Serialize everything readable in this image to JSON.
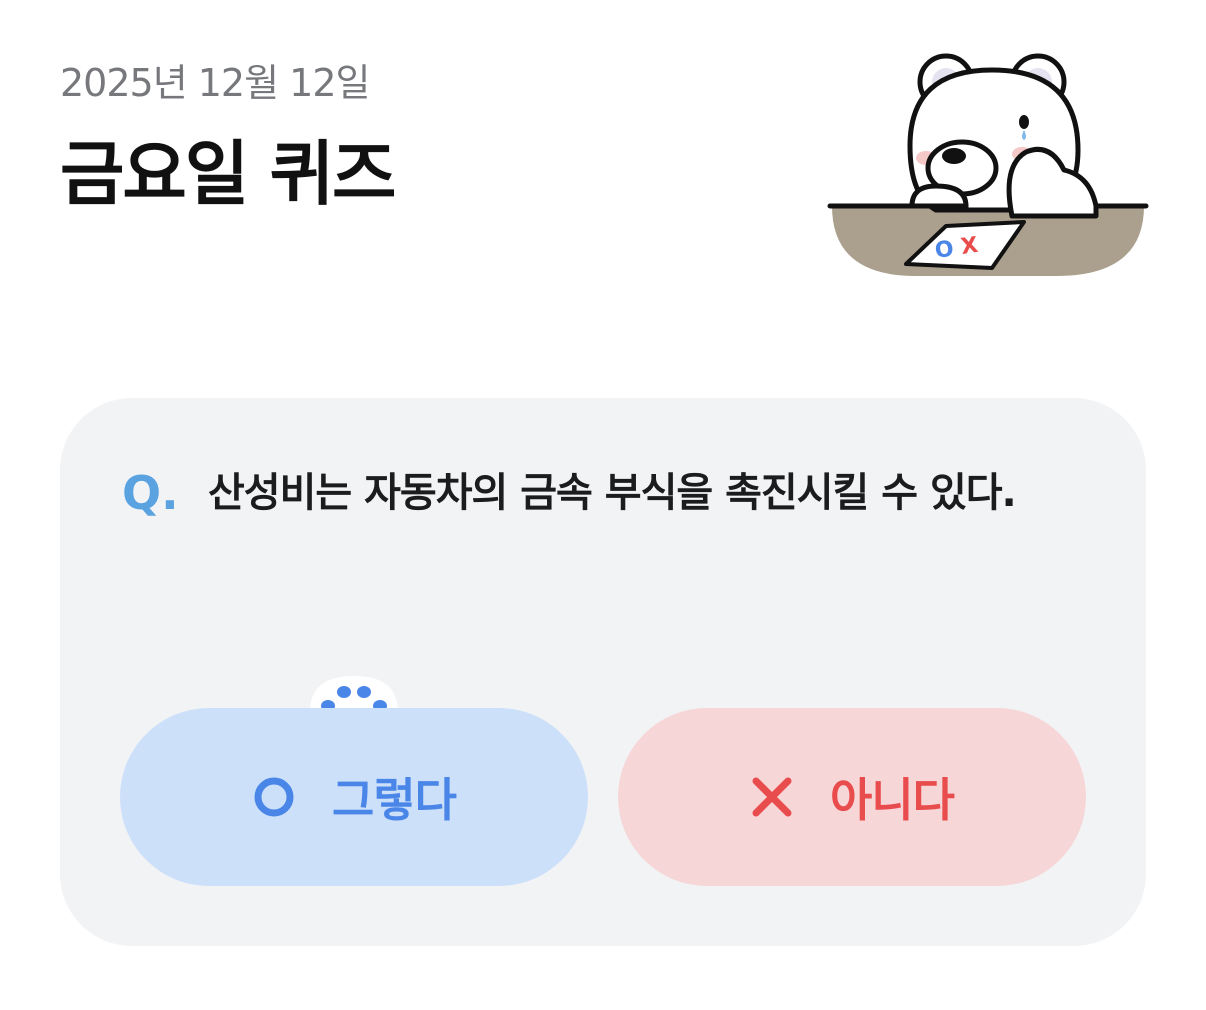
{
  "header": {
    "date": "2025년 12월 12일",
    "title": "금요일 퀴즈"
  },
  "mascot": {
    "icon": "polar-bear-quiz-icon",
    "paper_o": "O",
    "paper_x": "X"
  },
  "quiz": {
    "q_mark": "Q.",
    "question": "산성비는 자동차의 금속 부식을 촉진시킬 수 있다.",
    "answers": [
      {
        "label": "그렇다",
        "icon": "circle-o-icon",
        "color": "#4a86e8",
        "background": "#cde0fa"
      },
      {
        "label": "아니다",
        "icon": "cross-x-icon",
        "color": "#e94c4c",
        "background": "#f7d6d8"
      }
    ],
    "selected_hint_icon": "paw-icon"
  },
  "colors": {
    "card_background": "#f2f3f5",
    "q_accent": "#5aa2e0"
  }
}
